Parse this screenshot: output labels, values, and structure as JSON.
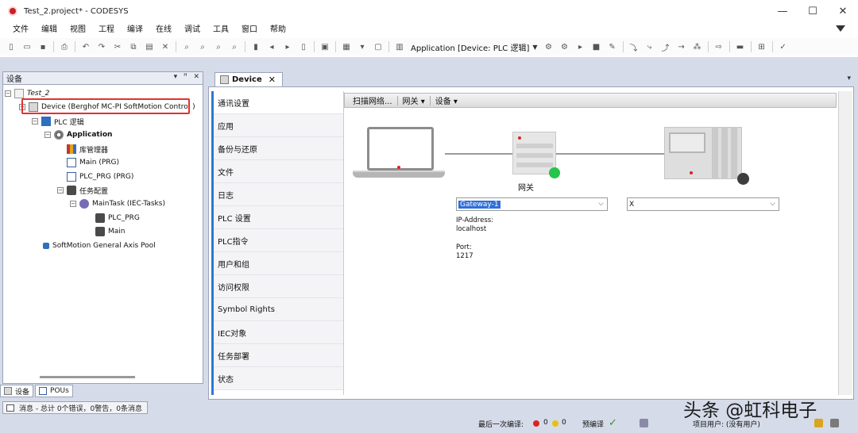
{
  "window": {
    "title": "Test_2.project* - CODESYS",
    "minimize": "—",
    "maximize": "☐",
    "close": "✕"
  },
  "menu": [
    "文件",
    "编辑",
    "视图",
    "工程",
    "编译",
    "在线",
    "调试",
    "工具",
    "窗口",
    "帮助"
  ],
  "toolbar": {
    "application_label": "Application [Device: PLC 逻辑]"
  },
  "device_panel": {
    "title": "设备",
    "controls": [
      "▾",
      "ᵸ",
      "✕"
    ],
    "tree": {
      "project": "Test_2",
      "device": "Device (Berghof MC-PI SoftMotion Control )",
      "plc_logic": "PLC 逻辑",
      "application": "Application",
      "library_manager": "库管理器",
      "main_prg": "Main (PRG)",
      "plc_prg": "PLC_PRG (PRG)",
      "task_config": "任务配置",
      "main_task": "MainTask (IEC-Tasks)",
      "task_plc_prg": "PLC_PRG",
      "task_main": "Main",
      "axis_pool": "SoftMotion General Axis Pool"
    },
    "tabs": [
      "设备",
      "POUs"
    ]
  },
  "messages": {
    "label": "消息 - 总计 0个错误，0警告，0条消息"
  },
  "editor": {
    "tab_label": "Device",
    "nav": [
      "通讯设置",
      "应用",
      "备份与还原",
      "文件",
      "日志",
      "PLC 设置",
      "PLC指令",
      "用户和组",
      "访问权限",
      "Symbol Rights",
      "IEC对象",
      "任务部署",
      "状态"
    ],
    "sub_toolbar": [
      "扫描网络...",
      "网关 ▾",
      "设备 ▾"
    ],
    "gateway_label": "网关",
    "gateway_combo": "Gateway-1",
    "device_combo": "X",
    "ip_label": "IP-Address:",
    "ip_value": "localhost",
    "port_label": "Port:",
    "port_value": "1217"
  },
  "statusbar": {
    "last_build": "最后一次编译:",
    "errors": "0",
    "warnings": "0",
    "precompile": "预编译",
    "project_user": "项目用户: (没有用户)"
  },
  "watermark": "头条 @虹科电子",
  "colors": {
    "accent": "#2a7ad6",
    "online_green": "#25c44a",
    "highlight_red": "#e53030",
    "error_red": "#d22"
  }
}
